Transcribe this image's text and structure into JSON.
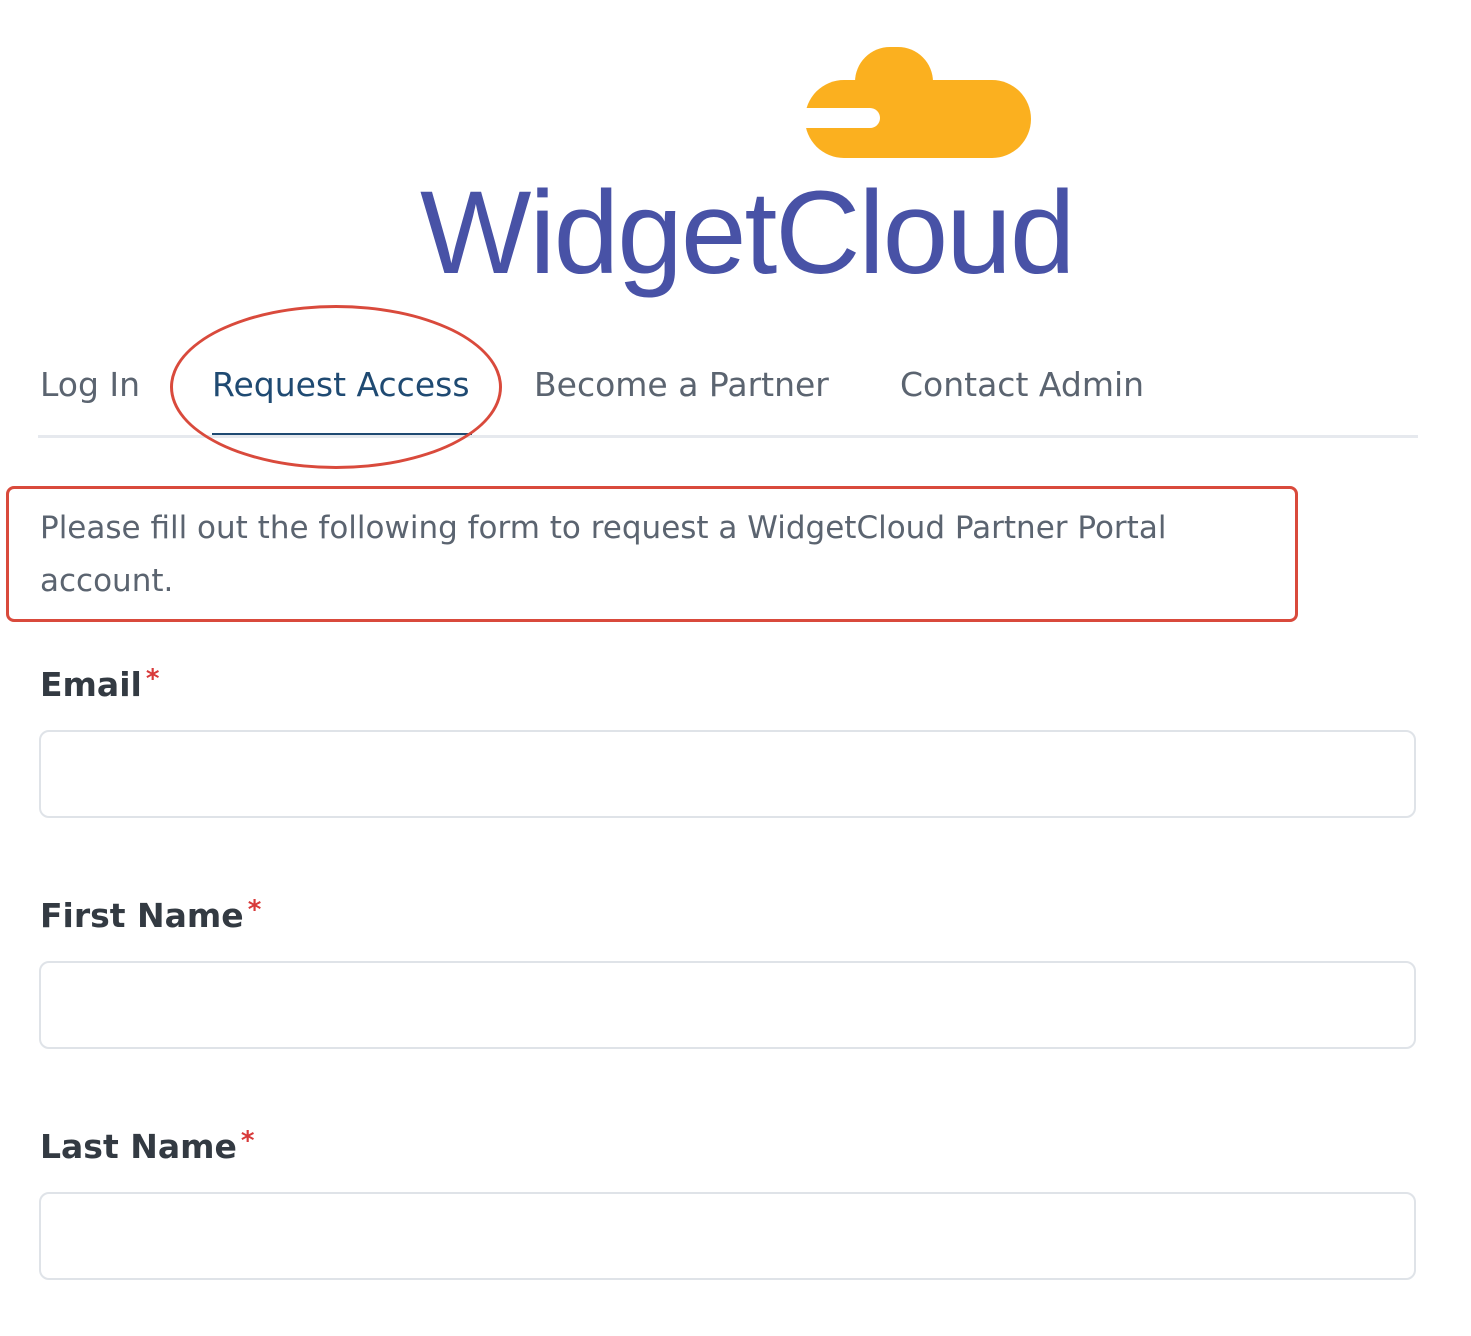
{
  "logo": {
    "text": "WidgetCloud",
    "cloud_color": "#fbb01f",
    "text_color": "#4852a6"
  },
  "tabs": [
    {
      "label": "Log In",
      "active": false
    },
    {
      "label": "Request Access",
      "active": true
    },
    {
      "label": "Become a Partner",
      "active": false
    },
    {
      "label": "Contact Admin",
      "active": false
    }
  ],
  "intro": "Please fill out the following form to request a WidgetCloud Partner Portal account.",
  "form": {
    "required_marker": "*",
    "fields": [
      {
        "label": "Email",
        "value": "",
        "placeholder": ""
      },
      {
        "label": "First Name",
        "value": "",
        "placeholder": ""
      },
      {
        "label": "Last Name",
        "value": "",
        "placeholder": ""
      }
    ]
  },
  "colors": {
    "active_tab": "#1f4a72",
    "annotation": "#d94a3c",
    "required": "#d83a3a"
  }
}
